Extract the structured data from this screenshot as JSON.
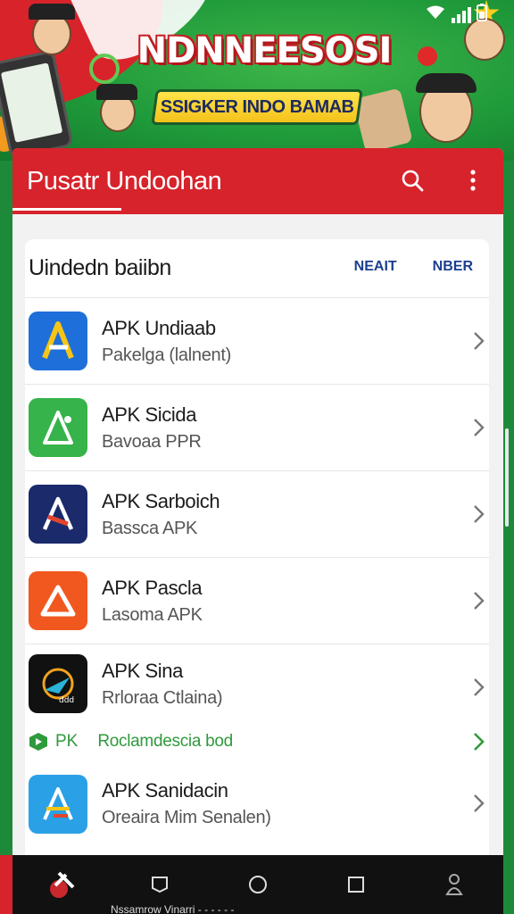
{
  "banner": {
    "title": "NDNNEESOSI",
    "subtitle": "SSIGKER INDO BAMAB",
    "accent_red": "#d8232a",
    "accent_green": "#1f9a3a",
    "accent_yellow": "#ffe34a"
  },
  "appbar": {
    "title": "Pusatr Undoohan",
    "search_icon": "search-icon",
    "more_icon": "more-vertical-icon",
    "color": "#d7232b"
  },
  "section": {
    "title": "Uindedn baiibn",
    "link_1": "NEAIT",
    "link_2": "NBER"
  },
  "items": [
    {
      "name": "APK Undiaab",
      "sub": "Pakelga (lalnent)",
      "icon": "apk-blue-a-icon",
      "color": "#1e6fd9"
    },
    {
      "name": "APK Sicida",
      "sub": "Bavoaa PPR",
      "icon": "apk-green-a-icon",
      "color": "#36b34a"
    },
    {
      "name": "APK Sarboich",
      "sub": "Bassca APK",
      "icon": "apk-navy-a-icon",
      "color": "#1a2a6b"
    },
    {
      "name": "APK Pascla",
      "sub": "Lasoma APK",
      "icon": "apk-orange-a-icon",
      "color": "#f1581f"
    },
    {
      "name": "APK Sina",
      "sub": "Rrloraa Ctlaina)",
      "icon": "apk-black-rocket-icon",
      "color": "#111111"
    }
  ],
  "promo": {
    "tag": "PK",
    "text": "Roclamdescia bod"
  },
  "last_item": {
    "name": "APK Sanidacin",
    "sub": "Oreaira Mim Senalen)",
    "icon": "apk-lightblue-a-icon",
    "color": "#2aa0e6"
  },
  "navbar": {
    "caption": "Nssamrow Vinarri - - - - - -",
    "buttons": [
      "app-logo-icon",
      "back-icon",
      "home-icon",
      "recents-icon",
      "person-icon"
    ]
  }
}
